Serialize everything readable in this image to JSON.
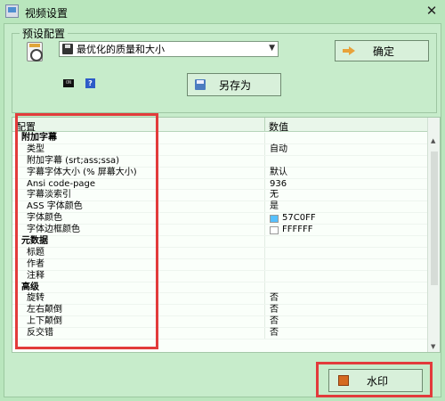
{
  "window": {
    "title": "视频设置",
    "close_glyph": "✕"
  },
  "preset": {
    "group_label": "预设配置",
    "selected": "最优化的质量和大小",
    "ok_label": "确定",
    "save_as_label": "另存为",
    "cmd_icon_text": "ON"
  },
  "table": {
    "col_config": "配置",
    "col_value": "数值",
    "rows": [
      {
        "name": "附加字幕",
        "value": "",
        "category": true
      },
      {
        "name": "类型",
        "value": "自动"
      },
      {
        "name": "附加字幕 (srt;ass;ssa)",
        "value": ""
      },
      {
        "name": "字幕字体大小 (% 屏幕大小)",
        "value": "默认"
      },
      {
        "name": "Ansi code-page",
        "value": "936"
      },
      {
        "name": "字幕淡索引",
        "value": "无"
      },
      {
        "name": "ASS 字体颜色",
        "value": "是"
      },
      {
        "name": "字体颜色",
        "value": "57C0FF",
        "swatch": "#57C0FF"
      },
      {
        "name": "字体边框颜色",
        "value": "FFFFFF",
        "swatch": "#FFFFFF"
      },
      {
        "name": "元数据",
        "value": "",
        "category": true
      },
      {
        "name": "标题",
        "value": ""
      },
      {
        "name": "作者",
        "value": ""
      },
      {
        "name": "注释",
        "value": ""
      },
      {
        "name": "高级",
        "value": "",
        "category": true
      },
      {
        "name": "旋转",
        "value": "否"
      },
      {
        "name": "左右颠倒",
        "value": "否"
      },
      {
        "name": "上下颠倒",
        "value": "否"
      },
      {
        "name": "反交错",
        "value": "否"
      }
    ]
  },
  "watermark": {
    "label": "水印"
  },
  "colors": {
    "background": "#b9e6bd",
    "highlight_outline": "#e23b3b",
    "font_color_swatch": "#57C0FF",
    "border_color_swatch": "#FFFFFF"
  }
}
